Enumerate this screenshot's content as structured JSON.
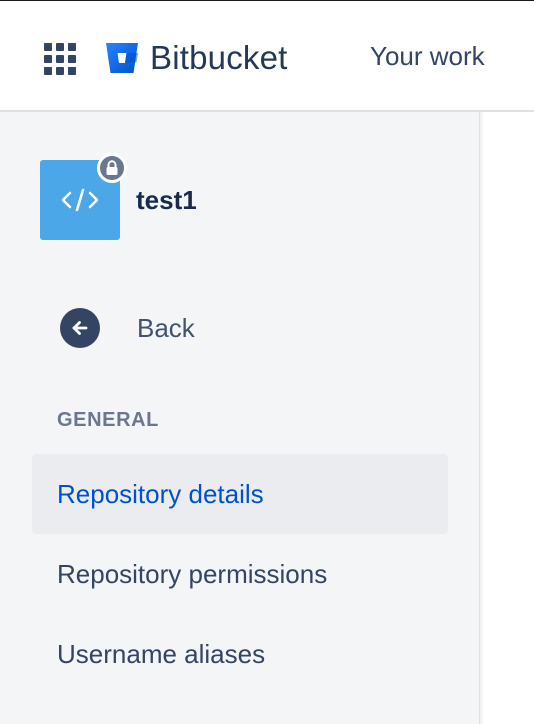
{
  "header": {
    "product_name": "Bitbucket",
    "nav_your_work": "Your work",
    "brand_color": "#2684FF"
  },
  "sidebar": {
    "repo": {
      "name": "test1",
      "avatar_icon": "code-icon",
      "private_icon": "lock-icon",
      "avatar_color": "#4BA7E7"
    },
    "back_label": "Back",
    "section_heading": "GENERAL",
    "items": [
      {
        "label": "Repository details",
        "selected": true
      },
      {
        "label": "Repository permissions",
        "selected": false
      },
      {
        "label": "Username aliases",
        "selected": false
      }
    ],
    "selected_color": "#0052CC"
  }
}
